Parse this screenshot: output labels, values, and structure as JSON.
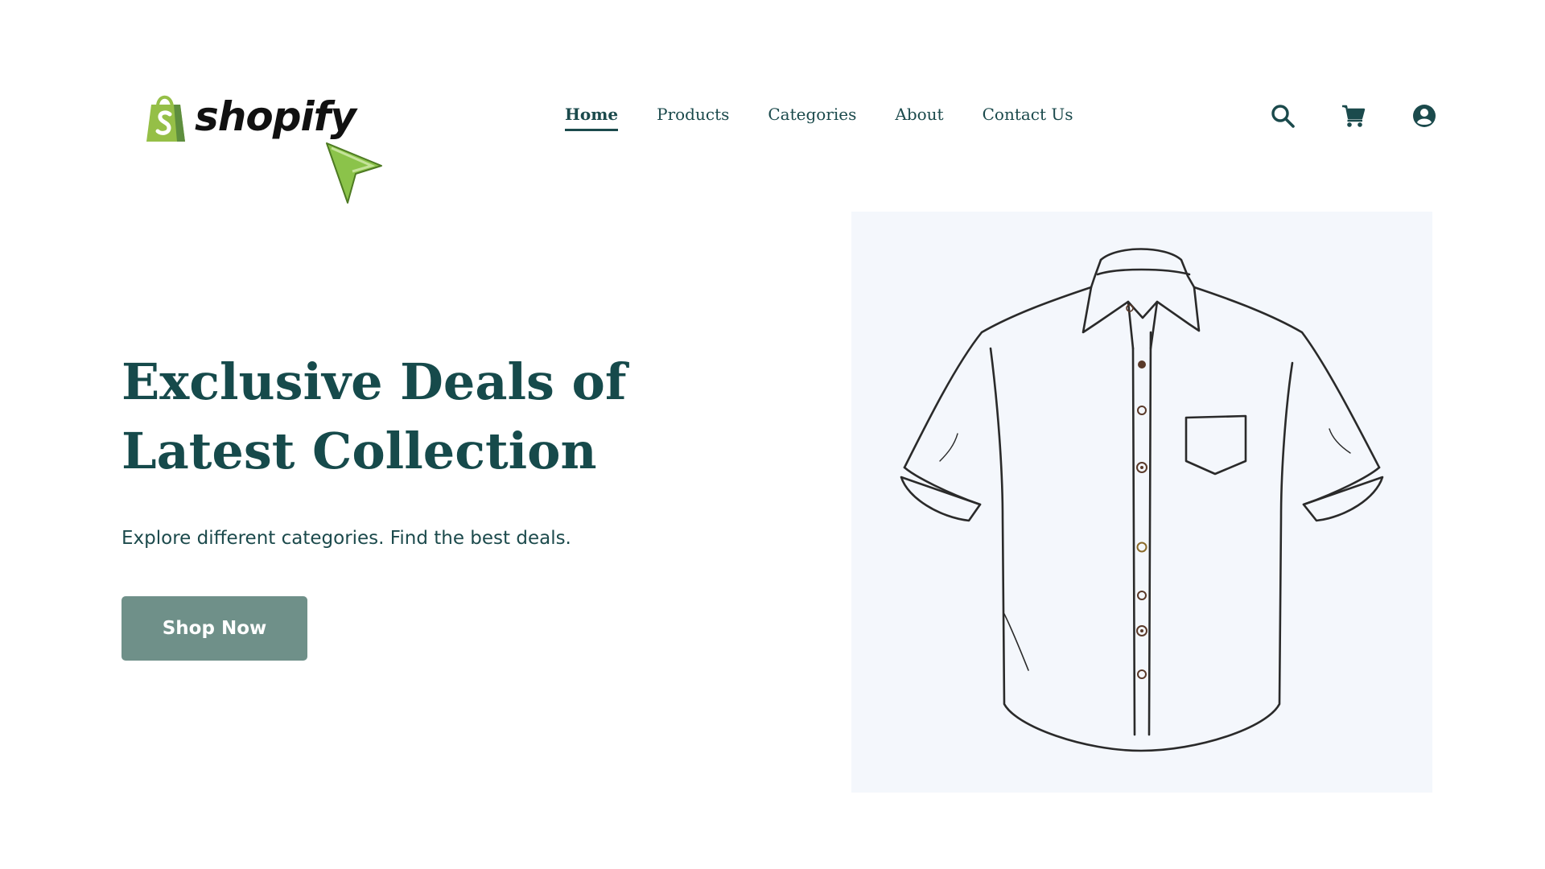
{
  "header": {
    "logo": {
      "text": "shopify",
      "icon": "shopify-bag-icon",
      "brand_color": "#95bf47"
    },
    "nav": [
      {
        "label": "Home",
        "active": true
      },
      {
        "label": "Products",
        "active": false
      },
      {
        "label": "Categories",
        "active": false
      },
      {
        "label": "About",
        "active": false
      },
      {
        "label": "Contact Us",
        "active": false
      }
    ],
    "icons": [
      "search-icon",
      "cart-icon",
      "account-icon"
    ]
  },
  "hero": {
    "title_line1": "Exclusive Deals of",
    "title_line2": "Latest Collection",
    "subtitle": "Explore different categories. Find the best deals.",
    "cta_label": "Shop Now",
    "image": "shirt-illustration"
  },
  "colors": {
    "primary_text": "#164a4b",
    "button_bg": "#6f9089",
    "image_bg": "#f4f7fc",
    "cursor": "#8bc34a"
  }
}
